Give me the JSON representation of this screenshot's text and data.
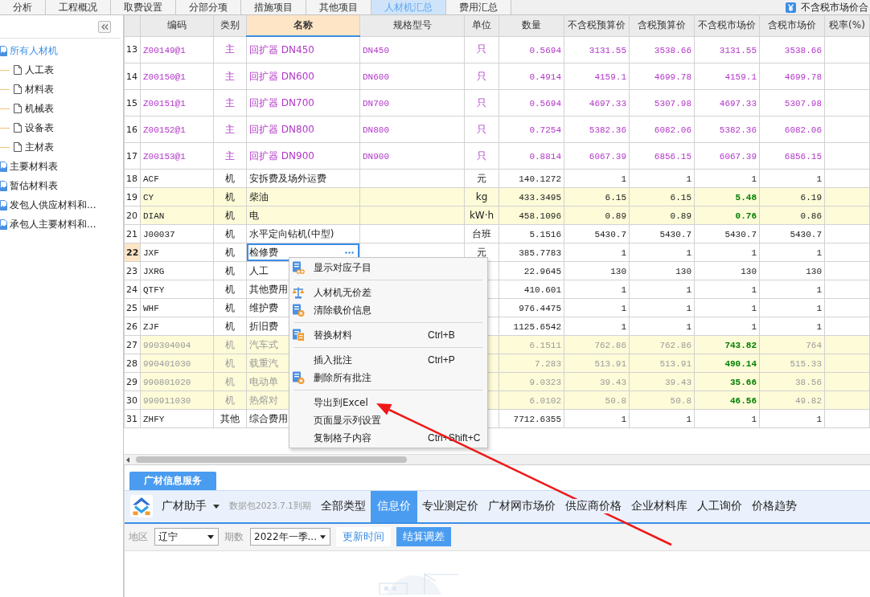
{
  "top_tabs": [
    {
      "label": "分析",
      "selected": false
    },
    {
      "label": "工程概况",
      "selected": false
    },
    {
      "label": "取费设置",
      "selected": false
    },
    {
      "label": "分部分项",
      "selected": false
    },
    {
      "label": "措施项目",
      "selected": false
    },
    {
      "label": "其他项目",
      "selected": false
    },
    {
      "label": "人材机汇总",
      "selected": true
    },
    {
      "label": "费用汇总",
      "selected": false
    }
  ],
  "tax_toggle": {
    "label": "不含税市场价合"
  },
  "sidebar": {
    "items": [
      {
        "label": "所有人材机",
        "selected": true,
        "children": [
          {
            "label": "人工表",
            "selected": false
          },
          {
            "label": "材料表",
            "selected": false
          },
          {
            "label": "机械表",
            "selected": false
          },
          {
            "label": "设备表",
            "selected": false
          },
          {
            "label": "主材表",
            "selected": false
          }
        ]
      },
      {
        "label": "主要材料表",
        "selected": false
      },
      {
        "label": "暂估材料表",
        "selected": false
      },
      {
        "label": "发包人供应材料和...",
        "selected": false
      },
      {
        "label": "承包人主要材料和...",
        "selected": false
      }
    ]
  },
  "table": {
    "columns": [
      {
        "label": "编码",
        "selected": false
      },
      {
        "label": "类别",
        "selected": false
      },
      {
        "label": "名称",
        "selected": true
      },
      {
        "label": "规格型号",
        "selected": false
      },
      {
        "label": "单位",
        "selected": false
      },
      {
        "label": "数量",
        "selected": false
      },
      {
        "label": "不含税预算价",
        "selected": false
      },
      {
        "label": "含税预算价",
        "selected": false
      },
      {
        "label": "不含税市场价",
        "selected": false
      },
      {
        "label": "含税市场价",
        "selected": false
      },
      {
        "label": "税率(%)",
        "selected": false
      }
    ],
    "rows": [
      {
        "number": "13",
        "kind": "main",
        "selected": false,
        "adjusted": false,
        "disabled": false,
        "code": "Z00149@1",
        "category": "主",
        "name": "回扩器 DN450",
        "spec": "DN450",
        "unit": "只",
        "quantity": "0.5694",
        "budget_excl_tax": "3131.55",
        "budget_incl_tax": "3538.66",
        "market_excl_tax": "3131.55",
        "market_incl_tax": "3538.66"
      },
      {
        "number": "14",
        "kind": "main",
        "selected": false,
        "adjusted": false,
        "disabled": false,
        "code": "Z00150@1",
        "category": "主",
        "name": "回扩器 DN600",
        "spec": "DN600",
        "unit": "只",
        "quantity": "0.4914",
        "budget_excl_tax": "4159.1",
        "budget_incl_tax": "4699.78",
        "market_excl_tax": "4159.1",
        "market_incl_tax": "4699.78"
      },
      {
        "number": "15",
        "kind": "main",
        "selected": false,
        "adjusted": false,
        "disabled": false,
        "code": "Z00151@1",
        "category": "主",
        "name": "回扩器 DN700",
        "spec": "DN700",
        "unit": "只",
        "quantity": "0.5694",
        "budget_excl_tax": "4697.33",
        "budget_incl_tax": "5307.98",
        "market_excl_tax": "4697.33",
        "market_incl_tax": "5307.98"
      },
      {
        "number": "16",
        "kind": "main",
        "selected": false,
        "adjusted": false,
        "disabled": false,
        "code": "Z00152@1",
        "category": "主",
        "name": "回扩器 DN800",
        "spec": "DN800",
        "unit": "只",
        "quantity": "0.7254",
        "budget_excl_tax": "5382.36",
        "budget_incl_tax": "6082.06",
        "market_excl_tax": "5382.36",
        "market_incl_tax": "6082.06"
      },
      {
        "number": "17",
        "kind": "main",
        "selected": false,
        "adjusted": false,
        "disabled": false,
        "code": "Z00153@1",
        "category": "主",
        "name": "回扩器 DN900",
        "spec": "DN900",
        "unit": "只",
        "quantity": "0.8814",
        "budget_excl_tax": "6067.39",
        "budget_incl_tax": "6856.15",
        "market_excl_tax": "6067.39",
        "market_incl_tax": "6856.15"
      },
      {
        "number": "18",
        "kind": "normal",
        "selected": false,
        "adjusted": false,
        "disabled": false,
        "code": "ACF",
        "category": "机",
        "name": "安拆费及场外运费",
        "unit": "元",
        "quantity": "140.1272",
        "budget_excl_tax": "1",
        "budget_incl_tax": "1",
        "market_excl_tax": "1",
        "market_incl_tax": "1"
      },
      {
        "number": "19",
        "kind": "normal",
        "selected": false,
        "adjusted": true,
        "disabled": false,
        "code": "CY",
        "category": "机",
        "name": "柴油",
        "unit": "kg",
        "quantity": "433.3495",
        "budget_excl_tax": "6.15",
        "budget_incl_tax": "6.15",
        "market_excl_tax": "5.48",
        "market_incl_tax": "6.19"
      },
      {
        "number": "20",
        "kind": "normal",
        "selected": false,
        "adjusted": true,
        "disabled": false,
        "code": "DIAN",
        "category": "机",
        "name": "电",
        "unit": "kW·h",
        "quantity": "458.1096",
        "budget_excl_tax": "0.89",
        "budget_incl_tax": "0.89",
        "market_excl_tax": "0.76",
        "market_incl_tax": "0.86"
      },
      {
        "number": "21",
        "kind": "normal",
        "selected": false,
        "adjusted": false,
        "disabled": false,
        "code": "J00037",
        "category": "机",
        "name": "水平定向钻机(中型)",
        "unit": "台班",
        "quantity": "5.1516",
        "budget_excl_tax": "5430.7",
        "budget_incl_tax": "5430.7",
        "market_excl_tax": "5430.7",
        "market_incl_tax": "5430.7"
      },
      {
        "number": "22",
        "kind": "normal",
        "selected": true,
        "adjusted": false,
        "disabled": false,
        "code": "JXF",
        "category": "机",
        "name": "检修费",
        "unit": "元",
        "quantity": "385.7783",
        "budget_excl_tax": "1",
        "budget_incl_tax": "1",
        "market_excl_tax": "1",
        "market_incl_tax": "1"
      },
      {
        "number": "23",
        "kind": "normal",
        "selected": false,
        "adjusted": false,
        "disabled": false,
        "code": "JXRG",
        "category": "机",
        "name": "人工",
        "quantity": "22.9645",
        "budget_excl_tax": "130",
        "budget_incl_tax": "130",
        "market_excl_tax": "130",
        "market_incl_tax": "130"
      },
      {
        "number": "24",
        "kind": "normal",
        "selected": false,
        "adjusted": false,
        "disabled": false,
        "code": "QTFY",
        "category": "机",
        "name": "其他费用",
        "quantity": "410.601",
        "budget_excl_tax": "1",
        "budget_incl_tax": "1",
        "market_excl_tax": "1",
        "market_incl_tax": "1"
      },
      {
        "number": "25",
        "kind": "normal",
        "selected": false,
        "adjusted": false,
        "disabled": false,
        "code": "WHF",
        "category": "机",
        "name": "维护费",
        "quantity": "976.4475",
        "budget_excl_tax": "1",
        "budget_incl_tax": "1",
        "market_excl_tax": "1",
        "market_incl_tax": "1"
      },
      {
        "number": "26",
        "kind": "normal",
        "selected": false,
        "adjusted": false,
        "disabled": false,
        "code": "ZJF",
        "category": "机",
        "name": "折旧费",
        "quantity": "1125.6542",
        "budget_excl_tax": "1",
        "budget_incl_tax": "1",
        "market_excl_tax": "1",
        "market_incl_tax": "1"
      },
      {
        "number": "27",
        "kind": "normal",
        "selected": false,
        "adjusted": true,
        "disabled": true,
        "code": "990304004",
        "category": "机",
        "name": "汽车式",
        "quantity": "6.1511",
        "budget_excl_tax": "762.86",
        "budget_incl_tax": "762.86",
        "market_excl_tax": "743.82",
        "market_incl_tax": "764"
      },
      {
        "number": "28",
        "kind": "normal",
        "selected": false,
        "adjusted": true,
        "disabled": true,
        "code": "990401030",
        "category": "机",
        "name": "载重汽",
        "quantity": "7.283",
        "budget_excl_tax": "513.91",
        "budget_incl_tax": "513.91",
        "market_excl_tax": "490.14",
        "market_incl_tax": "515.33"
      },
      {
        "number": "29",
        "kind": "normal",
        "selected": false,
        "adjusted": true,
        "disabled": true,
        "code": "990801020",
        "category": "机",
        "name": "电动单",
        "quantity": "9.0323",
        "budget_excl_tax": "39.43",
        "budget_incl_tax": "39.43",
        "market_excl_tax": "35.66",
        "market_incl_tax": "38.56"
      },
      {
        "number": "30",
        "kind": "normal",
        "selected": false,
        "adjusted": true,
        "disabled": true,
        "code": "990911030",
        "category": "机",
        "name": "热熔对",
        "quantity": "6.0102",
        "budget_excl_tax": "50.8",
        "budget_incl_tax": "50.8",
        "market_excl_tax": "46.56",
        "market_incl_tax": "49.82"
      },
      {
        "number": "31",
        "kind": "normal",
        "selected": false,
        "adjusted": false,
        "disabled": false,
        "code": "ZHFY",
        "category": "其他",
        "name": "综合费用",
        "quantity": "7712.6355",
        "budget_excl_tax": "1",
        "budget_incl_tax": "1",
        "market_excl_tax": "1",
        "market_incl_tax": "1"
      }
    ]
  },
  "context_menu": {
    "groups": [
      [
        {
          "label": "显示对应子目"
        }
      ],
      [
        {
          "label": "人材机无价差"
        },
        {
          "label": "清除载价信息"
        }
      ],
      [
        {
          "label": "替换材料",
          "shortcut": "Ctrl+B"
        }
      ],
      [
        {
          "label": "插入批注",
          "shortcut": "Ctrl+P"
        },
        {
          "label": "删除所有批注"
        }
      ],
      [
        {
          "label": "导出到Excel"
        },
        {
          "label": "页面显示列设置"
        },
        {
          "label": "复制格子内容",
          "shortcut": "Ctrl+Shift+C"
        }
      ]
    ]
  },
  "info_panel": {
    "tab": {
      "label": "广材信息服务",
      "selected": true
    },
    "assistant": {
      "label": "广材助手",
      "note": "数据包2023.7.1到期"
    },
    "source_tabs": [
      {
        "label": "全部类型",
        "selected": false
      },
      {
        "label": "信息价",
        "selected": true
      },
      {
        "label": "专业测定价",
        "selected": false
      },
      {
        "label": "广材网市场价",
        "selected": false
      },
      {
        "label": "供应商价格",
        "selected": false
      },
      {
        "label": "企业材料库",
        "selected": false
      },
      {
        "label": "人工询价",
        "selected": false
      },
      {
        "label": "价格趋势",
        "selected": false
      }
    ],
    "filters": [
      {
        "label": "地区",
        "value": "辽宁"
      },
      {
        "label": "期数",
        "value": "2022年一季..."
      }
    ],
    "buttons": [
      {
        "label": "更新时间",
        "kind": "secondary"
      },
      {
        "label": "结算调差",
        "kind": "primary"
      }
    ]
  }
}
